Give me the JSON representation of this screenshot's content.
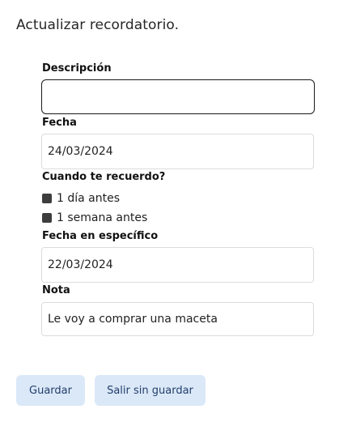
{
  "dialog": {
    "title": "Actualizar recordatorio."
  },
  "form": {
    "description": {
      "label": "Descripción",
      "value": ""
    },
    "date": {
      "label": "Fecha",
      "value": "24/03/2024"
    },
    "reminder": {
      "label": "Cuando te recuerdo?",
      "options": [
        {
          "label": "1 día antes"
        },
        {
          "label": "1 semana antes"
        }
      ]
    },
    "specific_date": {
      "label": "Fecha en específico",
      "value": "22/03/2024"
    },
    "note": {
      "label": "Nota",
      "value": "Le voy a comprar una maceta"
    }
  },
  "actions": {
    "save_label": "Guardar",
    "exit_label": "Salir sin guardar"
  },
  "colors": {
    "button_bg": "#dbe8f8",
    "button_text": "#213e6b",
    "checkbox_fill": "#3d3d3d"
  }
}
